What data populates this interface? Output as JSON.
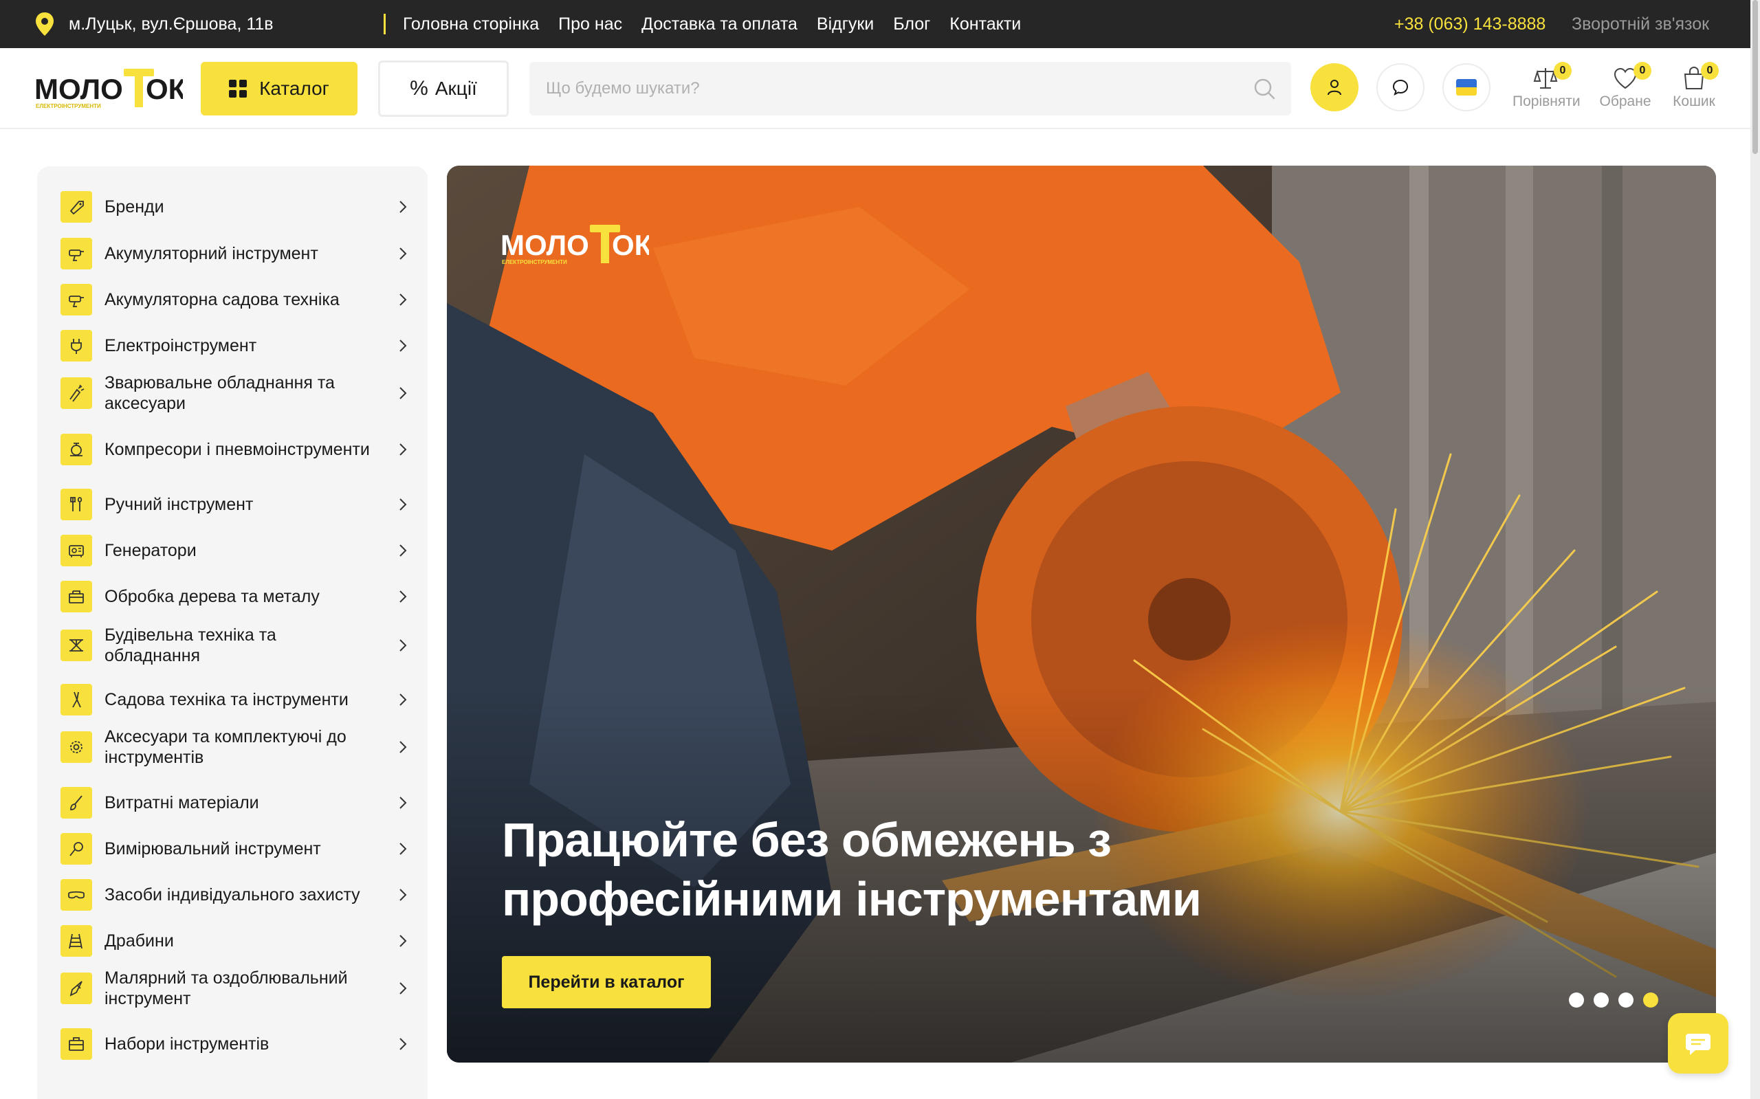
{
  "topbar": {
    "address": "м.Луцьк, вул.Єршова, 11в",
    "nav": [
      "Головна сторінка",
      "Про нас",
      "Доставка та оплата",
      "Відгуки",
      "Блог",
      "Контакти"
    ],
    "phone": "+38 (063) 143-8888",
    "feedback": "Зворотній зв'язок"
  },
  "brand": {
    "logo_word_left": "МОЛО",
    "logo_word_right": "ОК",
    "logo_sub": "ЕЛЕКТРОІНСТРУМЕНТИ",
    "accent_color": "#f8e13d",
    "dark_color": "#262626"
  },
  "header": {
    "catalog_label": "Каталог",
    "promo_label": "Акції",
    "search_placeholder": "Що будемо шукати?",
    "compare_label": "Порівняти",
    "compare_count": "0",
    "favorites_label": "Обране",
    "favorites_count": "0",
    "cart_label": "Кошик",
    "cart_count": "0"
  },
  "sidebar": {
    "items": [
      {
        "label": "Бренди",
        "icon": "tag-icon"
      },
      {
        "label": "Акумуляторний інструмент",
        "icon": "battery-drill-icon"
      },
      {
        "label": "Акумуляторна садова техніка",
        "icon": "battery-garden-icon"
      },
      {
        "label": "Електроінструмент",
        "icon": "plug-icon"
      },
      {
        "label": "Зварювальне обладнання та аксесуари",
        "icon": "welding-icon"
      },
      {
        "label": "Компресори і пневмоінструменти",
        "icon": "compressor-icon"
      },
      {
        "label": "Ручний інструмент",
        "icon": "hand-tools-icon"
      },
      {
        "label": "Генератори",
        "icon": "generator-icon"
      },
      {
        "label": "Обробка дерева та металу",
        "icon": "workbench-icon"
      },
      {
        "label": "Будівельна техніка та обладнання",
        "icon": "construction-icon"
      },
      {
        "label": "Садова техніка та інструменти",
        "icon": "garden-shears-icon"
      },
      {
        "label": "Аксесуари та комплектуючі до інструментів",
        "icon": "gear-icon"
      },
      {
        "label": "Витратні матеріали",
        "icon": "brush-icon"
      },
      {
        "label": "Вимірювальний інструмент",
        "icon": "measure-icon"
      },
      {
        "label": "Засоби індивідуального захисту",
        "icon": "goggles-icon"
      },
      {
        "label": "Драбини",
        "icon": "ladder-icon"
      },
      {
        "label": "Малярний та оздоблювальний інструмент",
        "icon": "spatula-icon"
      },
      {
        "label": "Набори інструментів",
        "icon": "toolbox-icon"
      }
    ]
  },
  "hero": {
    "title": "Працюйте без обмежень з професійними інструментами",
    "cta_label": "Перейти в каталог",
    "slide_count": 4,
    "active_slide": 4
  }
}
